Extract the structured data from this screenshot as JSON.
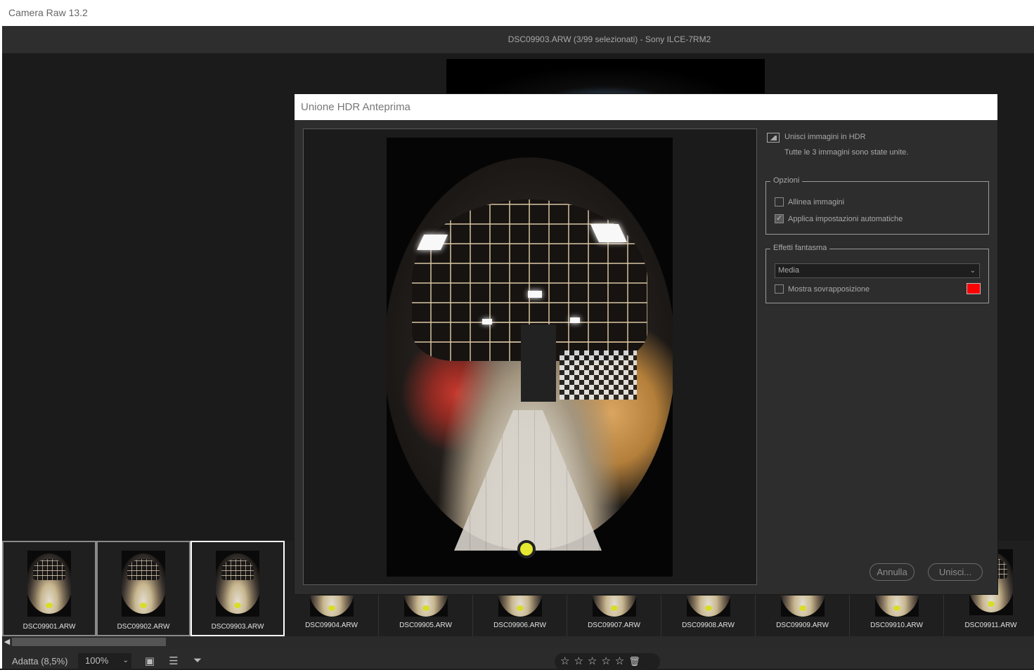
{
  "app": {
    "title": "Camera Raw 13.2"
  },
  "file_header": {
    "text": "DSC09903.ARW (3/99 selezionati)  -  Sony ILCE-7RM2"
  },
  "dialog": {
    "title": "Unione HDR  Anteprima",
    "info": {
      "title": "Unisci immagini in HDR",
      "subtitle": "Tutte le 3 immagini sono state unite."
    },
    "options": {
      "legend": "Opzioni",
      "align_label": "Allinea immagini",
      "align_checked": false,
      "auto_label": "Applica impostazioni automatiche",
      "auto_checked": true
    },
    "ghost": {
      "legend": "Effetti fantasma",
      "selected": "Media",
      "overlay_label": "Mostra sovrapposizione",
      "overlay_checked": false,
      "overlay_color": "#ff0000"
    },
    "buttons": {
      "cancel": "Annulla",
      "merge": "Unisci..."
    }
  },
  "filmstrip": [
    {
      "label": "DSC09901.ARW",
      "state": "selected"
    },
    {
      "label": "DSC09902.ARW",
      "state": "selected"
    },
    {
      "label": "DSC09903.ARW",
      "state": "current"
    },
    {
      "label": "DSC09904.ARW",
      "state": "normal"
    },
    {
      "label": "DSC09905.ARW",
      "state": "normal"
    },
    {
      "label": "DSC09906.ARW",
      "state": "normal"
    },
    {
      "label": "DSC09907.ARW",
      "state": "normal"
    },
    {
      "label": "DSC09908.ARW",
      "state": "normal"
    },
    {
      "label": "DSC09909.ARW",
      "state": "normal"
    },
    {
      "label": "DSC09910.ARW",
      "state": "normal"
    },
    {
      "label": "DSC09911.ARW",
      "state": "normal"
    }
  ],
  "bottombar": {
    "fit": "Adatta (8,5%)",
    "zoom": "100%",
    "stars": "☆☆☆☆☆",
    "icons": [
      "compare-icon",
      "sort-icon",
      "filter-icon",
      "trash-icon"
    ]
  }
}
